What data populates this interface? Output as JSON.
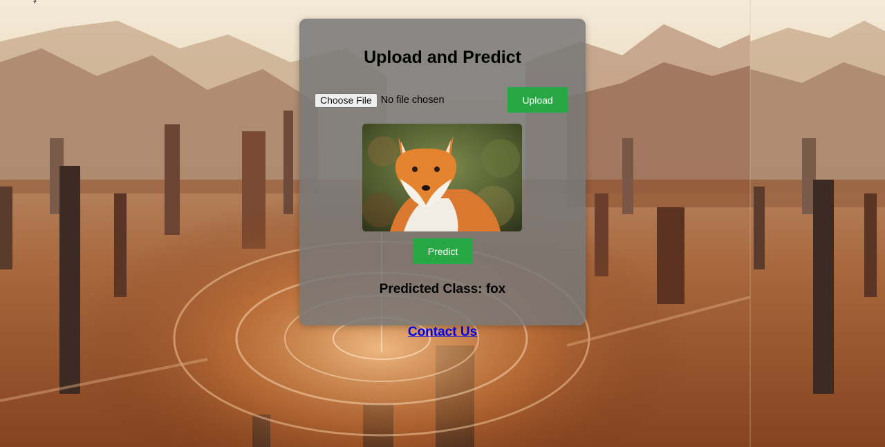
{
  "card": {
    "title": "Upload and Predict",
    "choose_file_label": "Choose File",
    "file_status": "No file chosen",
    "upload_label": "Upload",
    "predict_label": "Predict",
    "result_text": "Predicted Class: fox"
  },
  "footer": {
    "contact_label": "Contact Us"
  },
  "colors": {
    "accent": "#28a745",
    "link": "#0000ee",
    "card_bg": "#787878"
  },
  "preview": {
    "icon": "fox-photo"
  }
}
